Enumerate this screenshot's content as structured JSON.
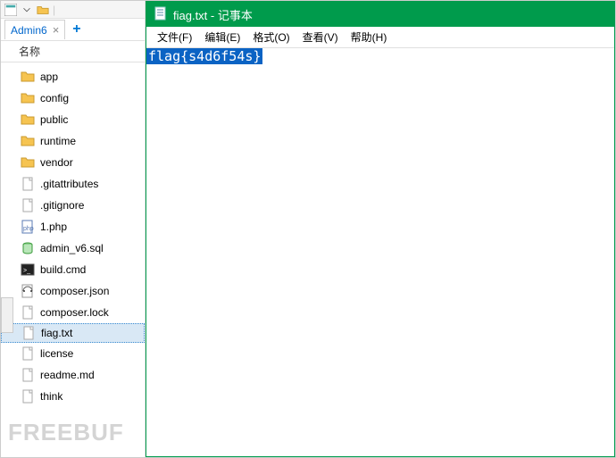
{
  "leftPanel": {
    "tab": {
      "label": "Admin6"
    },
    "columnHeader": "名称",
    "items": [
      {
        "name": "app",
        "type": "folder"
      },
      {
        "name": "config",
        "type": "folder"
      },
      {
        "name": "public",
        "type": "folder"
      },
      {
        "name": "runtime",
        "type": "folder"
      },
      {
        "name": "vendor",
        "type": "folder"
      },
      {
        "name": ".gitattributes",
        "type": "file"
      },
      {
        "name": ".gitignore",
        "type": "file"
      },
      {
        "name": "1.php",
        "type": "php"
      },
      {
        "name": "admin_v6.sql",
        "type": "sql"
      },
      {
        "name": "build.cmd",
        "type": "cmd"
      },
      {
        "name": "composer.json",
        "type": "json"
      },
      {
        "name": "composer.lock",
        "type": "file"
      },
      {
        "name": "fiag.txt",
        "type": "file",
        "selected": true
      },
      {
        "name": "license",
        "type": "file"
      },
      {
        "name": "readme.md",
        "type": "file"
      },
      {
        "name": "think",
        "type": "file"
      }
    ]
  },
  "notepad": {
    "title": "fiag.txt - 记事本",
    "menus": {
      "file": "文件(F)",
      "edit": "编辑(E)",
      "format": "格式(O)",
      "view": "查看(V)",
      "help": "帮助(H)"
    },
    "content": "flag{s4d6f54s}"
  },
  "watermark": "FREEBUF"
}
